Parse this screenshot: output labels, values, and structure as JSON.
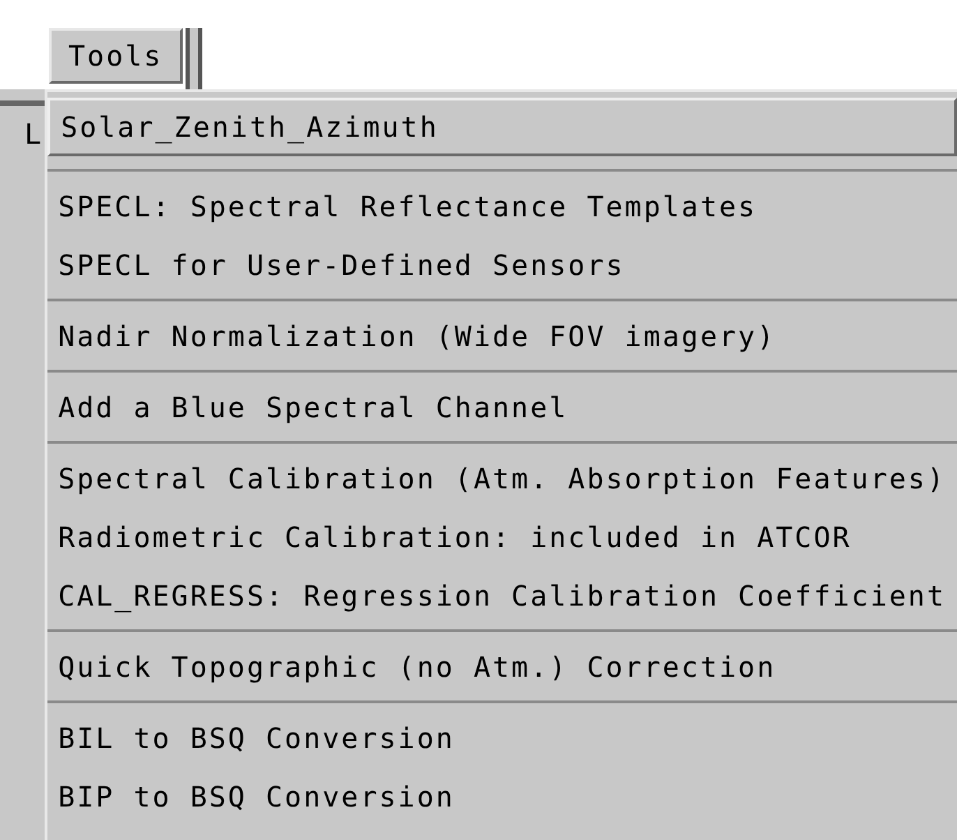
{
  "menubar": {
    "button": "Tools",
    "behind_text": "L"
  },
  "menu": {
    "groups": [
      {
        "items": [
          {
            "label": "Solar_Zenith_Azimuth",
            "selected": true
          }
        ]
      },
      {
        "items": [
          {
            "label": "SPECL: Spectral Reflectance Templates",
            "selected": false
          },
          {
            "label": "SPECL for User-Defined Sensors",
            "selected": false
          }
        ]
      },
      {
        "items": [
          {
            "label": "Nadir Normalization (Wide FOV imagery)",
            "selected": false
          }
        ]
      },
      {
        "items": [
          {
            "label": "Add a Blue Spectral Channel",
            "selected": false
          }
        ]
      },
      {
        "items": [
          {
            "label": "Spectral Calibration (Atm. Absorption Features)",
            "selected": false
          },
          {
            "label": "Radiometric Calibration: included in ATCOR",
            "selected": false
          },
          {
            "label": "CAL_REGRESS: Regression Calibration Coefficient",
            "selected": false
          }
        ]
      },
      {
        "items": [
          {
            "label": "Quick Topographic (no Atm.) Correction",
            "selected": false
          }
        ]
      },
      {
        "items": [
          {
            "label": "BIL to BSQ Conversion",
            "selected": false
          },
          {
            "label": "BIP to BSQ Conversion",
            "selected": false
          }
        ]
      }
    ]
  }
}
